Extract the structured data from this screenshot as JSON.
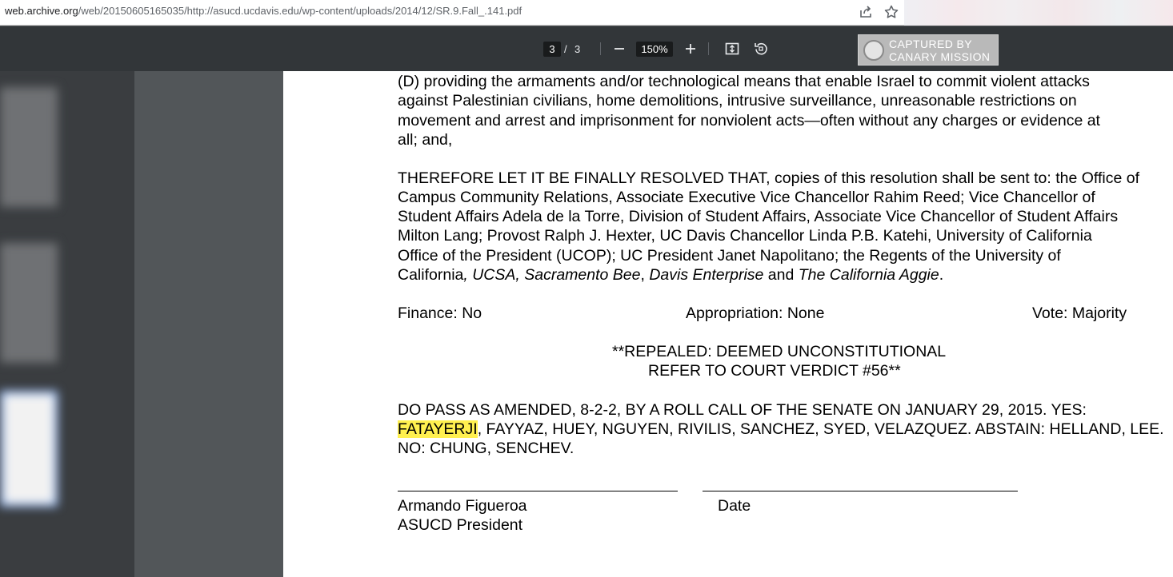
{
  "browser": {
    "url_host": "web.archive.org",
    "url_path": "/web/20150605165035/http://asucd.ucdavis.edu/wp-content/uploads/2014/12/SR.9.Fall_.141.pdf",
    "icons": [
      "share-icon",
      "star-icon"
    ]
  },
  "toolbar": {
    "current_page": "3",
    "separator": "/",
    "total_pages": "3",
    "zoom": "150%",
    "icons": [
      "zoom-out-icon",
      "zoom-in-icon",
      "fit-page-icon",
      "rotate-icon"
    ]
  },
  "watermark": {
    "line1": "CAPTURED BY",
    "line2": "CANARY MISSION"
  },
  "document": {
    "clause_d": [
      "(D) providing the armaments and/or technological means that enable Israel to commit violent attacks",
      "against Palestinian civilians, home demolitions,  intrusive surveillance, unreasonable restrictions on",
      "movement and arrest and imprisonment for nonviolent acts—often without any charges or evidence at",
      "all; and,"
    ],
    "resolved": [
      "THEREFORE LET IT BE FINALLY RESOLVED THAT, copies of this resolution shall be sent to: the Office of",
      "Campus Community Relations, Associate Executive Vice Chancellor Rahim Reed; Vice Chancellor of",
      "Student Affairs Adela de la Torre, Division of Student Affairs, Associate Vice Chancellor of Student Affairs",
      "Milton Lang; Provost Ralph J. Hexter, UC Davis Chancellor Linda P.B. Katehi, University of California",
      "Office of the President (UCOP); UC President Janet Napolitano; the Regents of the University of"
    ],
    "resolved_last": {
      "plain1": "California",
      "italic1": ", UCSA, Sacramento Bee",
      "plain2": ", ",
      "italic2": "Davis Enterprise",
      "plain3": " and ",
      "italic3": "The California Aggie",
      "plain4": "."
    },
    "finance": "Finance: No",
    "appropriation": "Appropriation: None",
    "vote": "Vote: Majority",
    "repealed_1": "**REPEALED: DEEMED UNCONSTITUTIONAL",
    "repealed_2": "REFER TO COURT VERDICT #56**",
    "do_pass_1": "DO PASS AS AMENDED, 8-2-2, BY A ROLL CALL OF THE SENATE ON JANUARY 29, 2015. YES:",
    "do_pass_2_highlight": "FATAYERJI",
    "do_pass_2_rest": ", FAYYAZ, HUEY, NGUYEN, RIVILIS, SANCHEZ, SYED, VELAZQUEZ. ABSTAIN: HELLAND, LEE.",
    "do_pass_3": "NO: CHUNG, SENCHEV.",
    "signer_name": "Armando Figueroa",
    "signer_title": "ASUCD President",
    "date_label": "Date"
  }
}
